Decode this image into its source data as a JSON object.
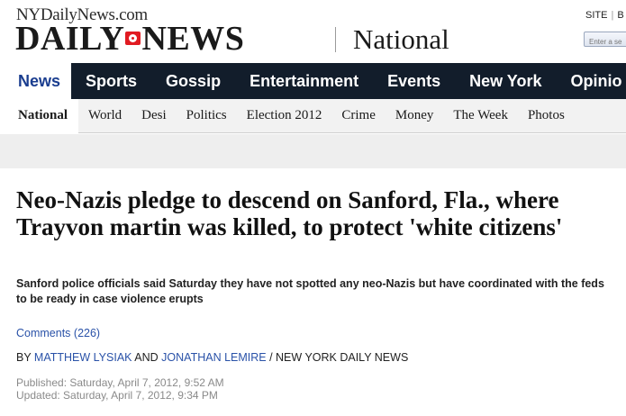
{
  "masthead": {
    "site_url": "NYDailyNews.com",
    "logo_left": "DAILY",
    "logo_right": "NEWS",
    "section": "National",
    "search_scope": [
      "SITE",
      "B"
    ],
    "search_placeholder": "Enter a se"
  },
  "primary_nav": {
    "items": [
      "News",
      "Sports",
      "Gossip",
      "Entertainment",
      "Events",
      "New York",
      "Opinio"
    ],
    "active": "News"
  },
  "secondary_nav": {
    "items": [
      "National",
      "World",
      "Desi",
      "Politics",
      "Election 2012",
      "Crime",
      "Money",
      "The Week",
      "Photos"
    ],
    "active": "National"
  },
  "article": {
    "headline": "Neo-Nazis pledge to descend on Sanford, Fla., where Trayvon martin was killed, to protect 'white citizens'",
    "subhead": "Sanford police officials said Saturday they have not spotted any neo-Nazis but have coordinated with the feds to be ready in case violence erupts",
    "comments": "Comments (226)",
    "byline": {
      "prefix": "BY ",
      "author1": "MATTHEW LYSIAK",
      "and": " AND ",
      "author2": "JONATHAN LEMIRE",
      "suffix": " / NEW YORK DAILY NEWS"
    },
    "published": "Published: Saturday, April 7, 2012, 9:52 AM",
    "updated": "Updated: Saturday, April 7, 2012, 9:34 PM"
  },
  "colors": {
    "nav_bg": "#121d2b",
    "active_nav_text": "#1a3d8f",
    "link": "#2a52a8",
    "logo_accent": "#e11b22"
  }
}
